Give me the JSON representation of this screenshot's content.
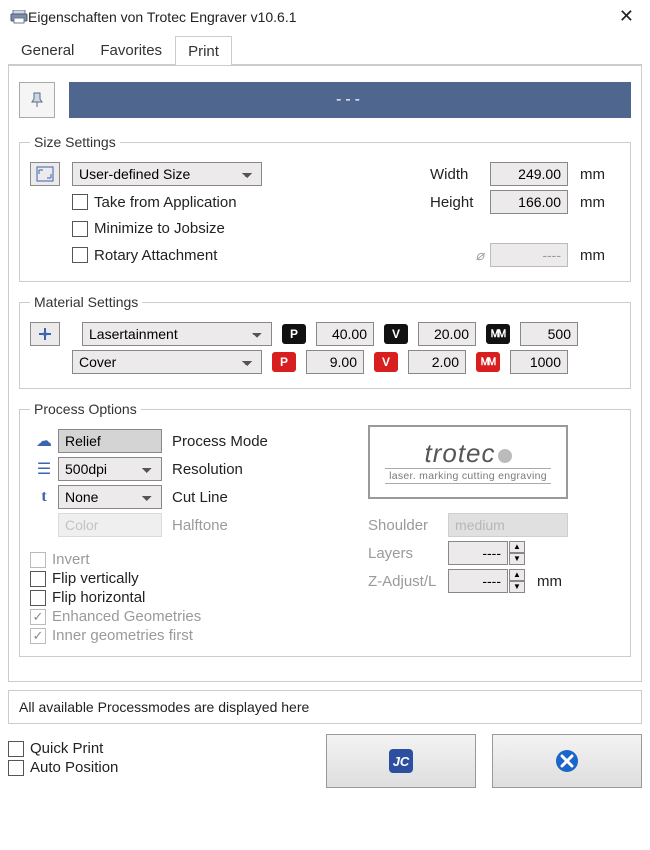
{
  "window": {
    "title": "Eigenschaften von Trotec Engraver v10.6.1"
  },
  "tabs": {
    "general": "General",
    "favorites": "Favorites",
    "print": "Print",
    "active": "Print"
  },
  "banner": {
    "text": "---"
  },
  "size": {
    "legend": "Size Settings",
    "mode": "User-defined Size",
    "width_label": "Width",
    "width": "249.00",
    "width_unit": "mm",
    "height_label": "Height",
    "height": "166.00",
    "height_unit": "mm",
    "take_from_app": "Take from Application",
    "minimize_jobsize": "Minimize to Jobsize",
    "rotary": "Rotary Attachment",
    "diam_symbol": "⌀",
    "diam_value": "----",
    "diam_unit": "mm"
  },
  "material": {
    "legend": "Material Settings",
    "group": "Lasertainment",
    "preset": "Cover",
    "row1": {
      "p": "40.00",
      "v": "20.00",
      "hz": "500"
    },
    "row2": {
      "p": "9.00",
      "v": "2.00",
      "hz": "1000"
    }
  },
  "process": {
    "legend": "Process Options",
    "mode_label": "Process Mode",
    "mode": "Relief",
    "res_label": "Resolution",
    "res": "500dpi",
    "cut_label": "Cut Line",
    "cut": "None",
    "halftone_label": "Halftone",
    "halftone": "Color",
    "invert": "Invert",
    "flip_v": "Flip vertically",
    "flip_h": "Flip horizontal",
    "enh_geo": "Enhanced Geometries",
    "inner_first": "Inner geometries first",
    "shoulder_label": "Shoulder",
    "shoulder": "medium",
    "layers_label": "Layers",
    "layers": "----",
    "zadj_label": "Z-Adjust/L",
    "zadj": "----",
    "zadj_unit": "mm",
    "logo_main": "trotec",
    "logo_sub": "laser. marking cutting engraving"
  },
  "footer": {
    "hint": "All available Processmodes are displayed here",
    "quick_print": "Quick Print",
    "auto_position": "Auto Position"
  }
}
